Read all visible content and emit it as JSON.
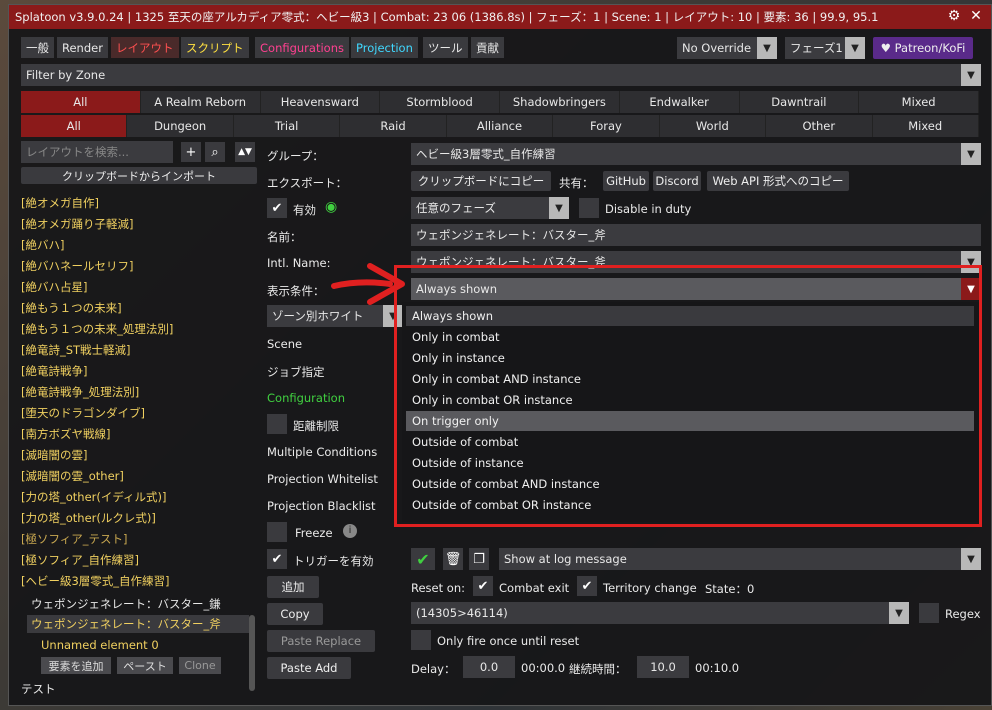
{
  "title": "Splatoon v3.9.0.24 | 1325 至天の座アルカディア零式：ヘビー級3 | Combat: 23 06 (1386.8s) | フェーズ：1 | Scene: 1 | レイアウト: 10 | 要素: 36 | 99.9, 95.1",
  "menu": [
    "一般",
    "Render",
    "レイアウト",
    "スクリプト",
    "Configurations",
    "Projection",
    "ツール",
    "貢献"
  ],
  "menu_colors": [
    "#eeeeee",
    "#eeeeee",
    "#ff5050",
    "#ffe040",
    "#ff4090",
    "#40d8ff",
    "#eeeeee",
    "#eeeeee"
  ],
  "override": "No Override",
  "phase": "フェーズ1",
  "patreon": "♥ Patreon/KoFi",
  "filter_zone": "Filter by Zone",
  "zone_row1": [
    "All",
    "A Realm Reborn",
    "Heavensward",
    "Stormblood",
    "Shadowbringers",
    "Endwalker",
    "Dawntrail",
    "Mixed"
  ],
  "zone_row2": [
    "All",
    "Dungeon",
    "Trial",
    "Raid",
    "Alliance",
    "Foray",
    "World",
    "Other",
    "Mixed"
  ],
  "search_placeholder": "レイアウトを検索...",
  "import_clipboard": "クリップボードからインポート",
  "layouts": [
    "[絶オメガ自作]",
    "[絶オメガ踊り子軽減]",
    "[絶バハ]",
    "[絶バハネールセリフ]",
    "[絶バハ占星]",
    "[絶もう１つの未来]",
    "[絶もう１つの未来_処理法別]",
    "[絶竜詩_ST戦士軽減]",
    "[絶竜詩戦争]",
    "[絶竜詩戦争_処理法別]",
    "[堕天のドラゴンダイブ]",
    "[南方ボズヤ戦線]",
    "[滅暗闇の雲]",
    "[滅暗闇の雲_other]",
    "[力の塔_other(イディル式)]",
    "[力の塔_other(ルクレ式)]",
    "[極ソフィア_テスト]",
    "[極ソフィア_自作練習]",
    "[ヘビー級3層零式_自作練習]"
  ],
  "sub_items": [
    "ウェポンジェネレート：バスター_鎌",
    "ウェポンジェネレート：バスター_斧"
  ],
  "unnamed": "Unnamed element 0",
  "add_element": "要素を追加",
  "paste": "ペースト",
  "clone": "Clone",
  "test": "テスト",
  "group_label": "グループ：",
  "group_value": "ヘビー級3層零式_自作練習",
  "export_label": "エクスポート：",
  "copy_clipboard": "クリップボードにコピー",
  "share_label": "共有：",
  "github": "GitHub",
  "discord": "Discord",
  "webapi": "Web API 形式へのコピー",
  "enabled_label": "有効",
  "phase_any": "任意のフェーズ",
  "disable_duty": "Disable in duty",
  "name_label": "名前：",
  "name_value": "ウェポンジェネレート：バスター_斧",
  "intl_label": "Intl. Name:",
  "intl_value": "ウェポンジェネレート：バスター_斧",
  "display_label": "表示条件：",
  "display_value": "Always shown",
  "zone_white": "ゾーン別ホワイト",
  "scene_label": "Scene",
  "job_label": "ジョブ指定",
  "config_label": "Configuration",
  "distance_label": "距離制限",
  "multi_label": "Multiple Conditions",
  "proj_white": "Projection Whitelist",
  "proj_black": "Projection Blacklist",
  "freeze": "Freeze",
  "trigger_label": "トリガーを有効",
  "add_label": "追加",
  "copy_label": "Copy",
  "paste_replace": "Paste Replace",
  "paste_add": "Paste Add",
  "show_log": "Show at log message",
  "reset_on": "Reset on:",
  "combat_exit": "Combat exit",
  "territory_change": "Territory change",
  "state": "State：0",
  "trigger_value": "(14305>46114)",
  "regex": "Regex",
  "once_fire": "Only fire once until reset",
  "delay_label": "Delay：",
  "delay_value": "0.0",
  "delay_time": "00:00.0",
  "duration_label": "継続時間：",
  "duration_value": "10.0",
  "duration_time": "00:10.0",
  "options": [
    "Always shown",
    "Only in combat",
    "Only in instance",
    "Only in combat AND instance",
    "Only in combat OR instance",
    "On trigger only",
    "Outside of combat",
    "Outside of instance",
    "Outside of combat AND instance",
    "Outside of combat OR instance"
  ],
  "highlighted_option": "On trigger only"
}
